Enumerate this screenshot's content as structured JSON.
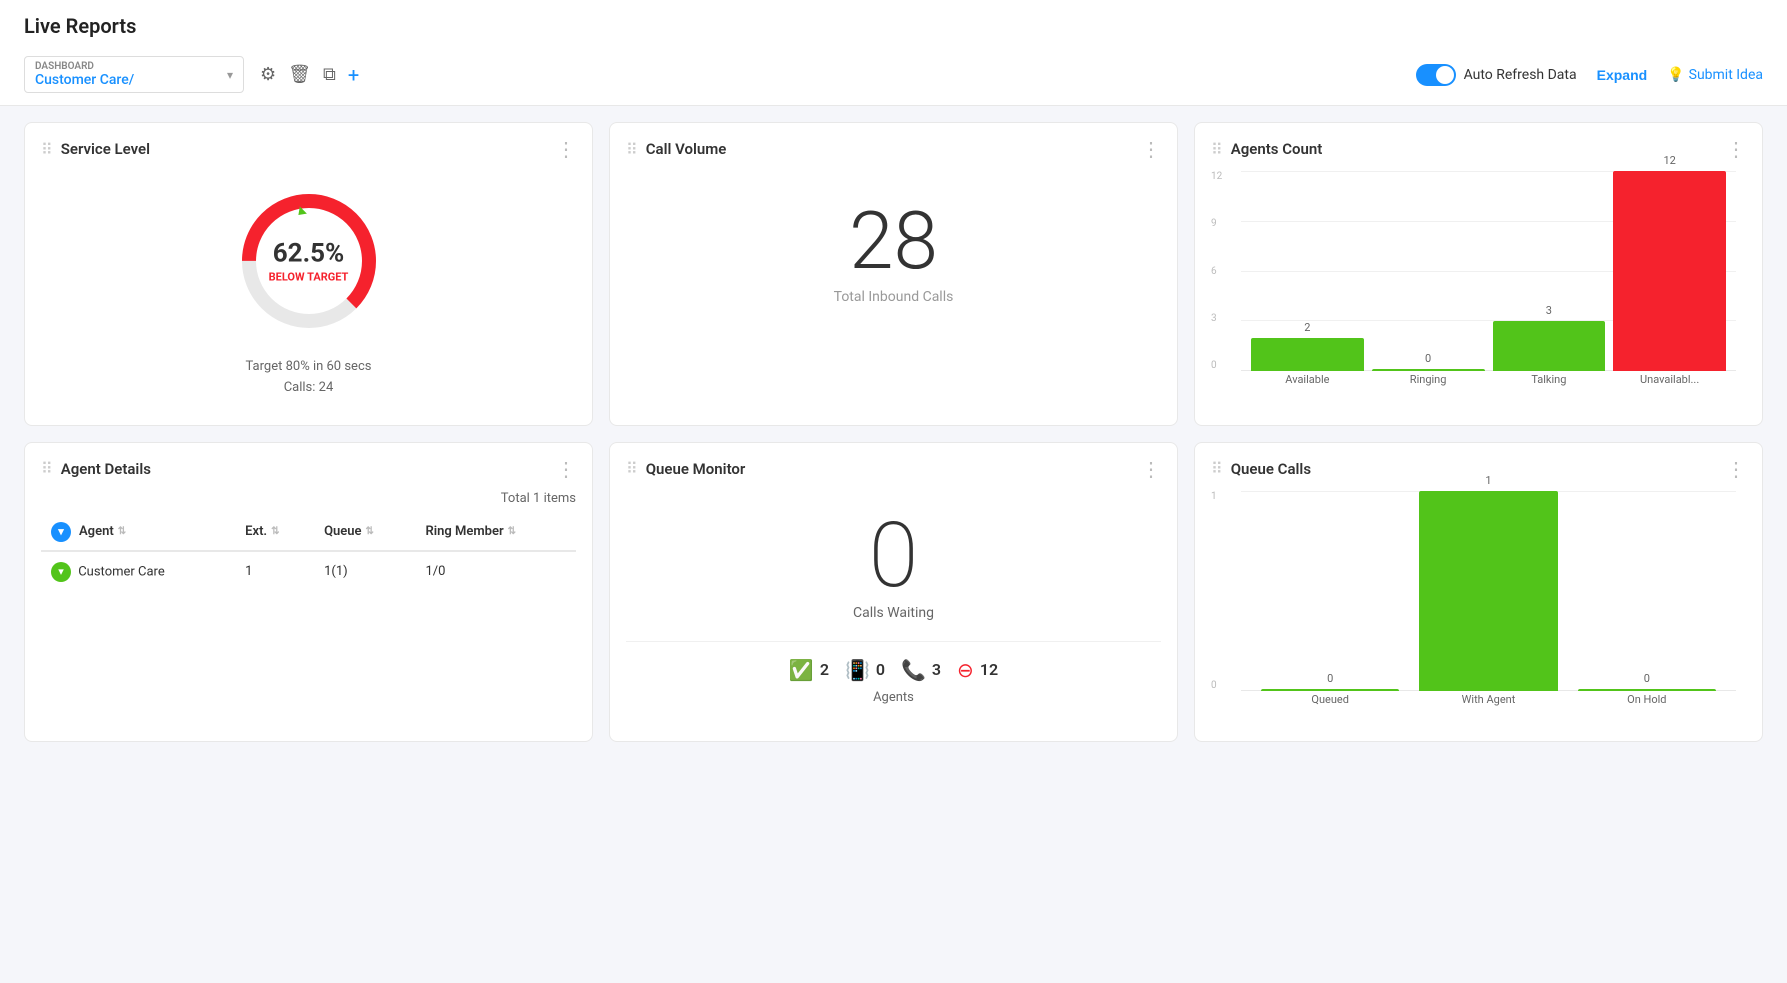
{
  "page": {
    "title": "Live Reports"
  },
  "toolbar": {
    "dashboard_label": "DASHBOARD",
    "dashboard_value": "Customer Care/",
    "auto_refresh_label": "Auto Refresh Data",
    "expand_label": "Expand",
    "submit_idea_label": "Submit Idea"
  },
  "service_level": {
    "title": "Service Level",
    "percentage": "62.5%",
    "status": "BELOW TARGET",
    "meta1": "Target 80% in 60 secs",
    "meta2": "Calls: 24",
    "donut_filled": 62.5,
    "color_filled": "#f5222d",
    "color_empty": "#e8e8e8"
  },
  "call_volume": {
    "title": "Call Volume",
    "number": "28",
    "label": "Total Inbound Calls"
  },
  "agents_count": {
    "title": "Agents Count",
    "bars": [
      {
        "label": "Available",
        "value": 2,
        "color": "#52c41a"
      },
      {
        "label": "Ringing",
        "value": 0,
        "color": "#52c41a"
      },
      {
        "label": "Talking",
        "value": 3,
        "color": "#52c41a"
      },
      {
        "label": "Unavailabl...",
        "value": 12,
        "color": "#f5222d"
      }
    ],
    "y_ticks": [
      12,
      9,
      6,
      3,
      0
    ],
    "max_value": 12
  },
  "agent_details": {
    "title": "Agent Details",
    "total_label": "Total 1 items",
    "columns": [
      "Agent",
      "Ext.",
      "Queue",
      "Ring Member"
    ],
    "rows": [
      {
        "agent": "Customer Care",
        "ext": "1",
        "queue": "1(1)",
        "ring_member": "1/0"
      }
    ]
  },
  "queue_monitor": {
    "title": "Queue Monitor",
    "calls_waiting_number": "0",
    "calls_waiting_label": "Calls Waiting",
    "stats": [
      {
        "icon": "✓",
        "value": "2",
        "color": "#52c41a",
        "type": "check"
      },
      {
        "icon": "↗",
        "value": "0",
        "color": "#52c41a",
        "type": "ring"
      },
      {
        "icon": "☎",
        "value": "3",
        "color": "#52c41a",
        "type": "phone"
      },
      {
        "icon": "⊖",
        "value": "12",
        "color": "#f5222d",
        "type": "minus"
      }
    ],
    "agents_label": "Agents"
  },
  "queue_calls": {
    "title": "Queue Calls",
    "bars": [
      {
        "label": "Queued",
        "value": 0,
        "color": "#52c41a"
      },
      {
        "label": "With Agent",
        "value": 1,
        "color": "#52c41a"
      },
      {
        "label": "On Hold",
        "value": 0,
        "color": "#52c41a"
      }
    ],
    "max_value": 1,
    "y_top": 1,
    "y_bottom": 0
  }
}
